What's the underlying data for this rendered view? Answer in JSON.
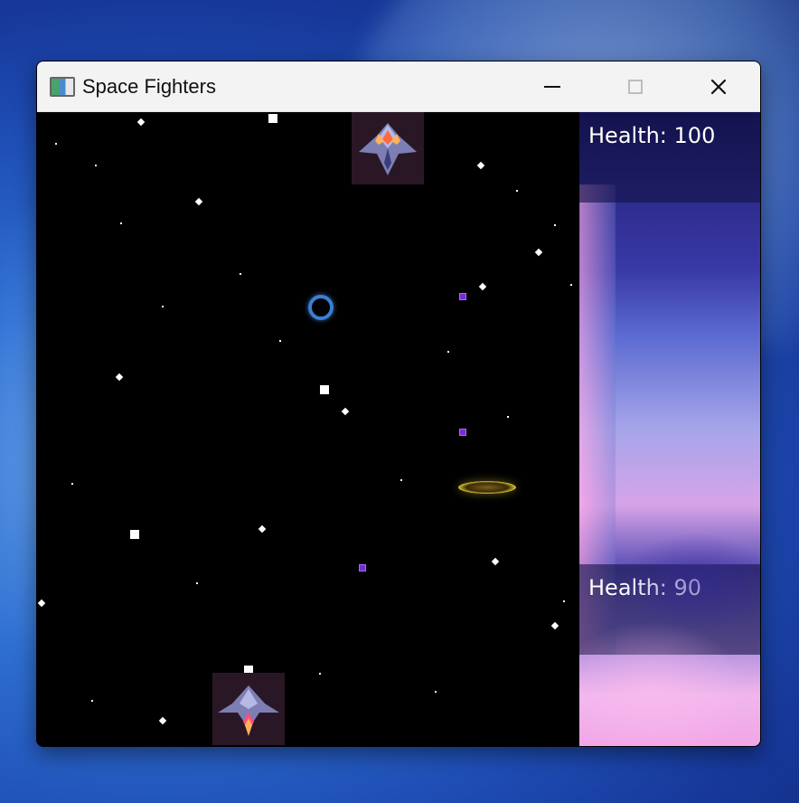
{
  "window": {
    "title": "Space Fighters",
    "controls": {
      "minimize_icon": "minimize-icon",
      "maximize_icon": "maximize-icon",
      "close_icon": "close-icon"
    }
  },
  "hud": {
    "enemy_health": "Health: 100",
    "player_health": "Health: 90"
  },
  "colors": {
    "space_background": "#000000",
    "enemy_projectile": "#7a2bd6",
    "ring": "#d8c235",
    "hud_text": "#ffffff"
  }
}
